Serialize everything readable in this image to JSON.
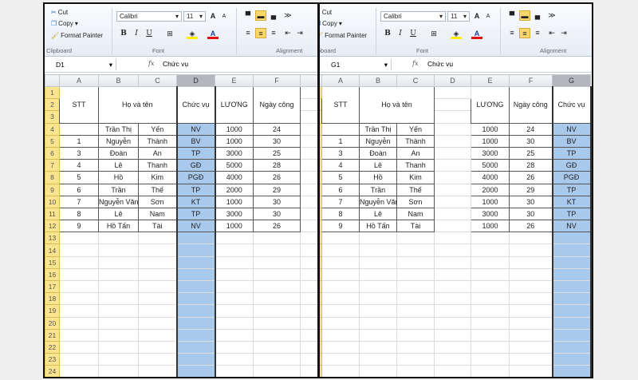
{
  "colors": {
    "selection": "#a8c8ec",
    "row_header": "#fbe48e",
    "highlight_button": "#f8d86a"
  },
  "ribbon": {
    "cut": "Cut",
    "copy": "Copy",
    "format_painter": "Format Painter",
    "clipboard": "Clipboard",
    "font_name": "Calibri",
    "font_size": "11",
    "font": "Font",
    "alignment": "Alignment",
    "bold": "B",
    "italic": "I",
    "underline": "U"
  },
  "left": {
    "name_box": "D1",
    "formula": "Chức vụ",
    "columns": [
      "A",
      "B",
      "C",
      "D",
      "E",
      "F",
      ""
    ],
    "selected_col": "D",
    "headers": {
      "stt": "STT",
      "name": "Họ và tên",
      "position": "Chức vụ",
      "salary": "LƯƠNG",
      "days": "Ngày công"
    },
    "rows": [
      {
        "stt": "",
        "first": "Trần Thị",
        "last": "Yến",
        "position": "NV",
        "salary": "1000",
        "days": "24"
      },
      {
        "stt": "1",
        "first": "Nguyễn",
        "last": "Thành",
        "position": "BV",
        "salary": "1000",
        "days": "30"
      },
      {
        "stt": "3",
        "first": "Đoàn",
        "last": "An",
        "position": "TP",
        "salary": "3000",
        "days": "25"
      },
      {
        "stt": "4",
        "first": "Lê",
        "last": "Thanh",
        "position": "GĐ",
        "salary": "5000",
        "days": "28"
      },
      {
        "stt": "5",
        "first": "Hồ",
        "last": "Kim",
        "position": "PGĐ",
        "salary": "4000",
        "days": "26"
      },
      {
        "stt": "6",
        "first": "Trần",
        "last": "Thế",
        "position": "TP",
        "salary": "2000",
        "days": "29"
      },
      {
        "stt": "7",
        "first": "Nguyễn Văn",
        "last": "Sơn",
        "position": "KT",
        "salary": "1000",
        "days": "30"
      },
      {
        "stt": "8",
        "first": "Lê",
        "last": "Nam",
        "position": "TP",
        "salary": "3000",
        "days": "30"
      },
      {
        "stt": "9",
        "first": "Hồ Tấn",
        "last": "Tài",
        "position": "NV",
        "salary": "1000",
        "days": "26"
      }
    ]
  },
  "right": {
    "name_box": "G1",
    "formula": "Chức vụ",
    "columns": [
      "A",
      "B",
      "C",
      "D",
      "E",
      "F",
      "G"
    ],
    "selected_col": "G"
  }
}
